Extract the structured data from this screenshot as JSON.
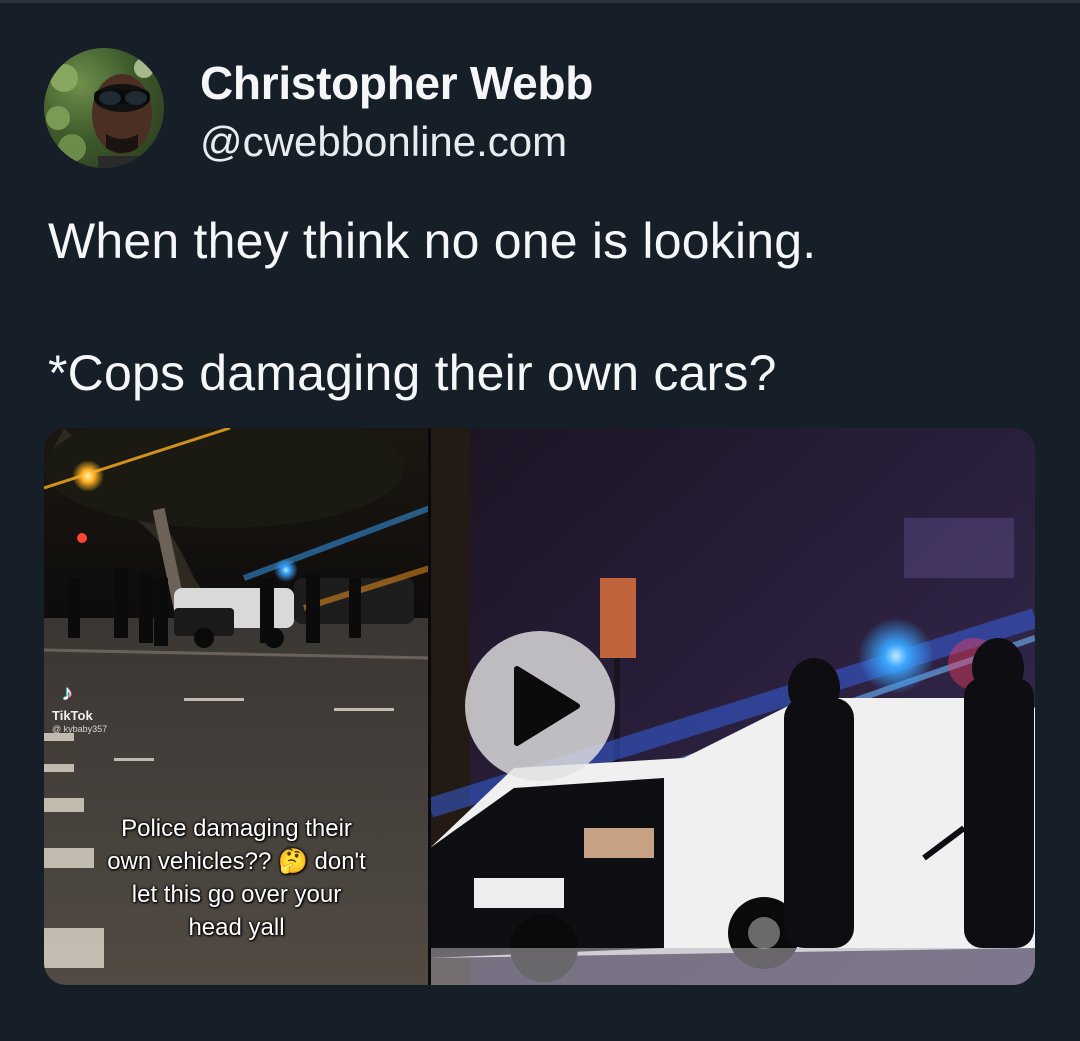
{
  "author": {
    "display_name": "Christopher Webb",
    "handle": "@cwebbonline.com"
  },
  "post": {
    "text_line_1": "When they think no one is looking.",
    "text_line_2": "*Cops damaging their own cars?"
  },
  "video": {
    "watermark_app": "TikTok",
    "watermark_user": "@ kybaby357",
    "caption_lines": [
      "Police damaging their",
      "own vehicles?? 🤔 don't",
      "let this go over your",
      "head yall"
    ],
    "play_icon": "play-icon"
  },
  "colors": {
    "background": "#161e28",
    "text": "#f4f6f8",
    "play_button": "#e1e1e1"
  }
}
